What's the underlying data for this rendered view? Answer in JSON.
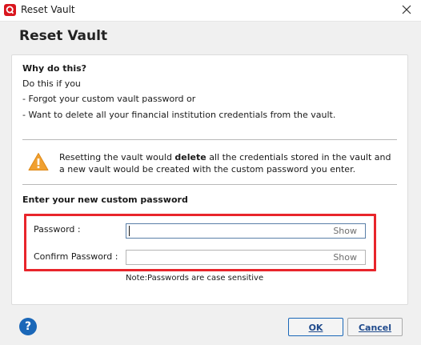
{
  "window": {
    "title": "Reset Vault",
    "app_icon_color": "#d9161e"
  },
  "dialog": {
    "heading": "Reset Vault",
    "why": {
      "title": "Why do this?",
      "lines": [
        "Do this if you",
        "- Forgot your custom vault password or",
        "- Want to delete all your financial institution credentials from the vault."
      ]
    },
    "warning": {
      "icon": "warning-triangle-icon",
      "icon_color": "#f0a030",
      "text_before": "Resetting the vault would ",
      "text_bold": "delete",
      "text_after": " all the credentials stored in the vault and a new vault would be created with the custom password you enter."
    },
    "password_section": {
      "heading": "Enter your new custom password",
      "password_label": "Password :",
      "password_value": "",
      "password_show": "Show",
      "confirm_label": "Confirm Password :",
      "confirm_value": "",
      "confirm_show": "Show",
      "note": "Note:Passwords are case sensitive",
      "highlight_color": "#e8252b"
    }
  },
  "footer": {
    "help_icon": "help-icon",
    "help_glyph": "?",
    "ok_label": "OK",
    "cancel_label": "Cancel"
  }
}
